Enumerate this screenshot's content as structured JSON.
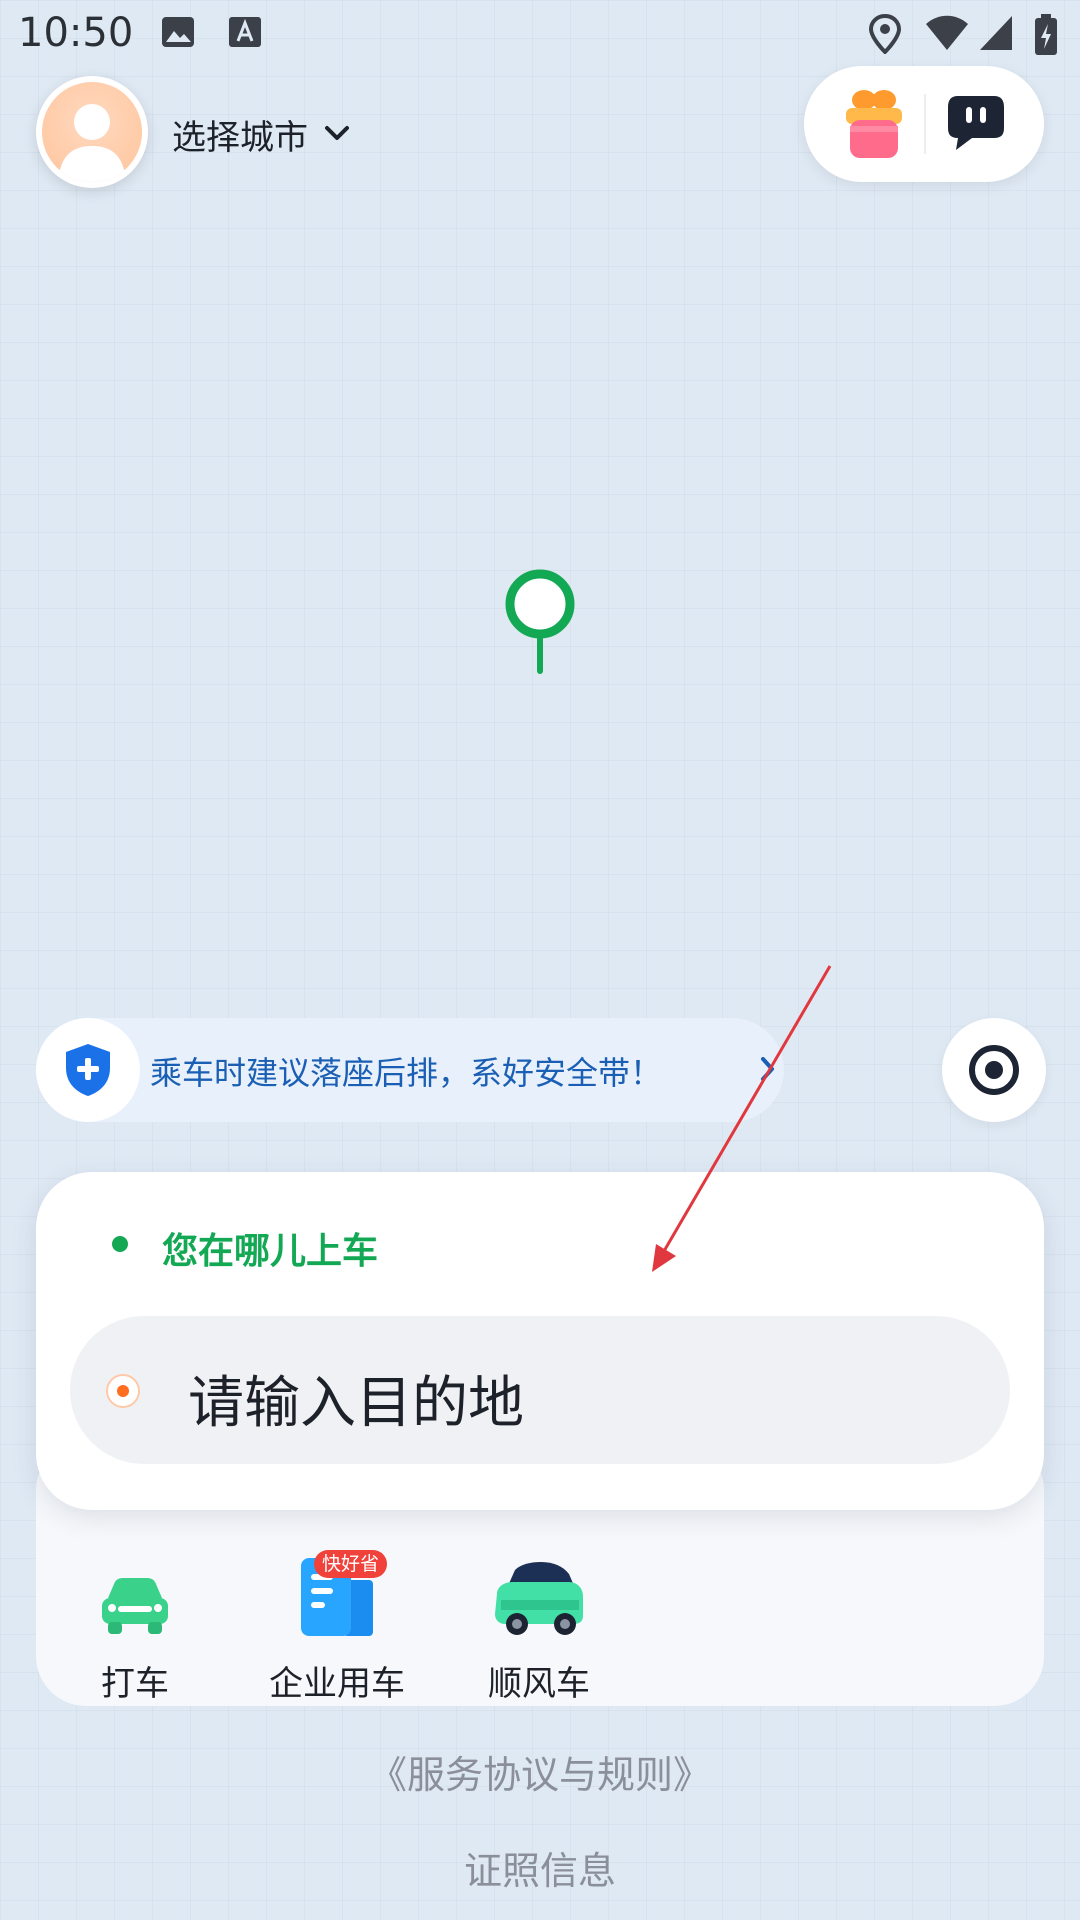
{
  "status_bar": {
    "time": "10:50",
    "icons": [
      "image-icon",
      "text-a-icon",
      "location-icon",
      "wifi-icon",
      "signal-icon",
      "battery-charging-icon"
    ]
  },
  "header": {
    "city_select_label": "选择城市",
    "avatar_icon": "user-avatar-icon",
    "actions": [
      "gift-icon",
      "message-bubble-icon"
    ]
  },
  "map": {
    "pin_color": "#13a853"
  },
  "safety_banner": {
    "text": "乘车时建议落座后排，系好安全带！",
    "icon": "shield-plus-icon"
  },
  "trip": {
    "pickup_text": "您在哪儿上车",
    "destination_placeholder": "请输入目的地"
  },
  "services": [
    {
      "label": "打车",
      "icon": "car-icon"
    },
    {
      "label": "企业用车",
      "icon": "building-icon",
      "badge": "快好省"
    },
    {
      "label": "顺风车",
      "icon": "carpool-car-icon"
    }
  ],
  "footer": {
    "agreement": "《服务协议与规则》",
    "license": "证照信息"
  },
  "colors": {
    "accent_green": "#13a853",
    "accent_blue": "#1a5fb4",
    "badge_red": "#f0423a",
    "destination_orange": "#ff6d1f",
    "annotation_arrow": "#e0383e"
  }
}
